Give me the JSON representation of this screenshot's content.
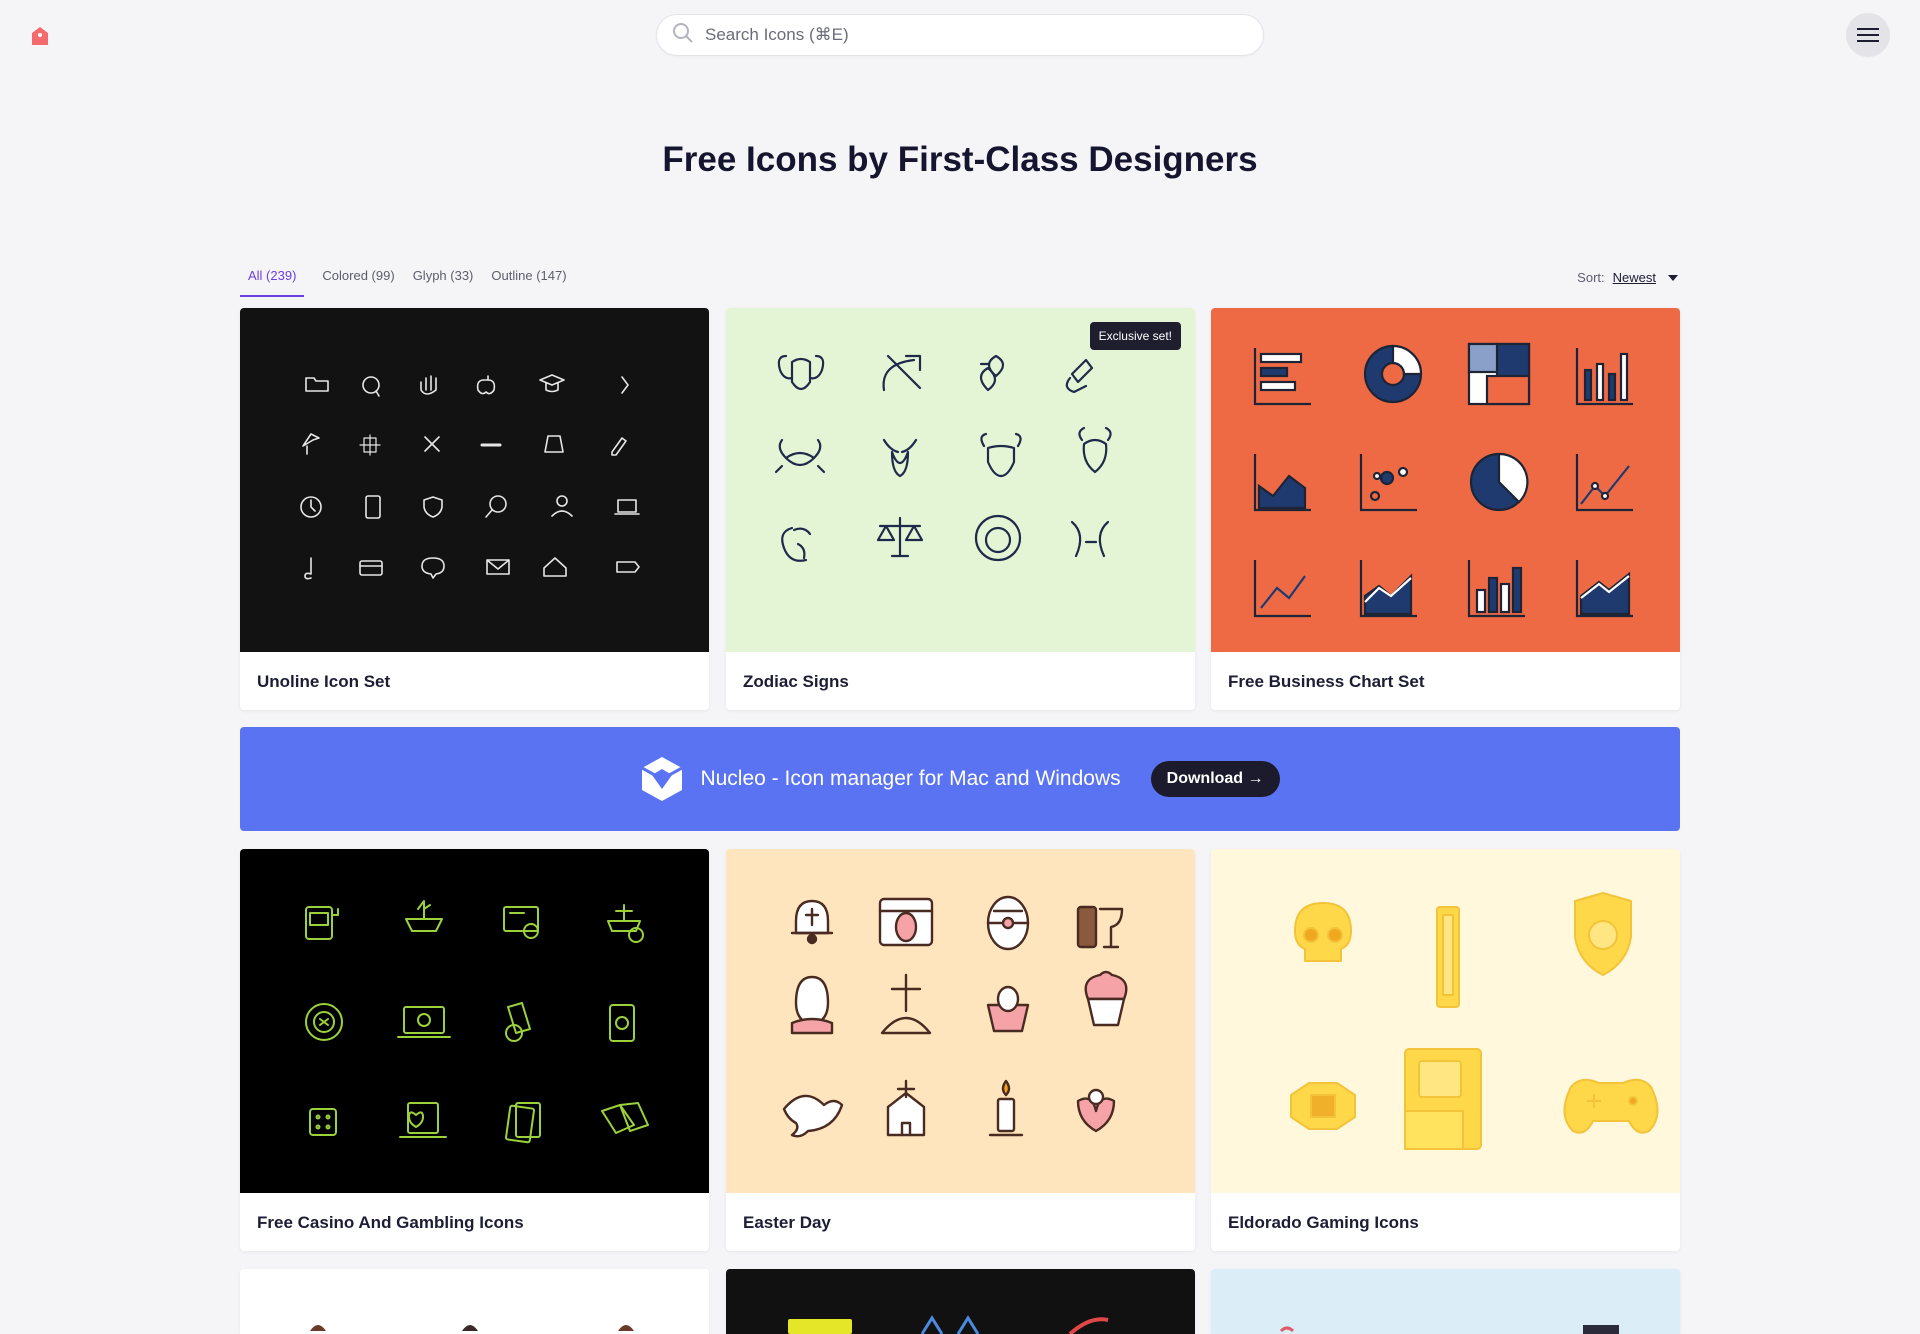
{
  "search": {
    "placeholder": "Search Icons (⌘E)"
  },
  "page_title": "Free Icons by First-Class Designers",
  "tabs": [
    {
      "label": "All (239)",
      "active": true
    },
    {
      "label": "Colored (99)"
    },
    {
      "label": "Glyph (33)"
    },
    {
      "label": "Outline (147)"
    }
  ],
  "sort": {
    "label": "Sort:",
    "value": "Newest"
  },
  "cards": [
    {
      "title": "Unoline Icon Set",
      "bg": "#121212"
    },
    {
      "title": "Zodiac Signs",
      "bg": "#e3f5d5",
      "badge": "Exclusive set!"
    },
    {
      "title": "Free Business Chart Set",
      "bg": "#ee6a45"
    },
    {
      "title": "Free Casino And Gambling Icons",
      "bg": "#000000"
    },
    {
      "title": "Easter Day",
      "bg": "#ffe5bd"
    },
    {
      "title": "Eldorado Gaming Icons",
      "bg": "#fff8dd"
    }
  ],
  "promo": {
    "text": "Nucleo - Icon manager for Mac and Windows",
    "button": "Download →",
    "bg": "#5a73f2"
  }
}
